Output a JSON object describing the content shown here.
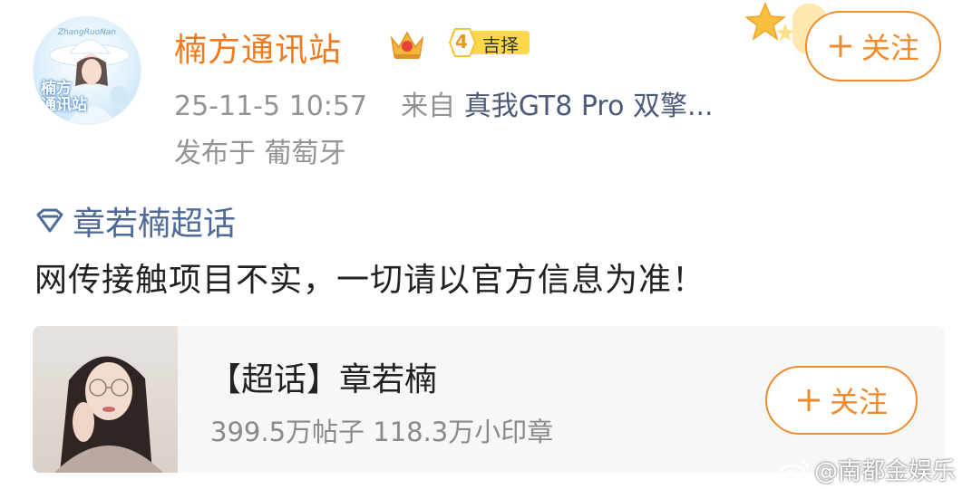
{
  "post": {
    "author": {
      "avatar_text": "楠方\n通讯站",
      "avatar_script": "ZhangRuoNan",
      "name": "楠方通讯站",
      "badge_icon": "crown-icon",
      "level": "4",
      "level_label": "吉择"
    },
    "meta": {
      "timestamp": "25-11-5 10:57",
      "from_label": "来自",
      "device": "真我GT8 Pro 双擎...",
      "location": "发布于 葡萄牙"
    },
    "follow_label": "关注",
    "topic": {
      "icon": "super-topic-icon",
      "label": "章若楠超话"
    },
    "text": "网传接触项目不实，一切请以官方信息为准！"
  },
  "card": {
    "title": "【超话】章若楠",
    "stats": "399.5万帖子 118.3万小印章",
    "follow_label": "关注"
  },
  "watermark": {
    "text": "@南都金娱乐"
  },
  "colors": {
    "accent": "#f08a2a",
    "username": "#f07a1c",
    "topic": "#4e6a98",
    "meta": "#939393"
  }
}
